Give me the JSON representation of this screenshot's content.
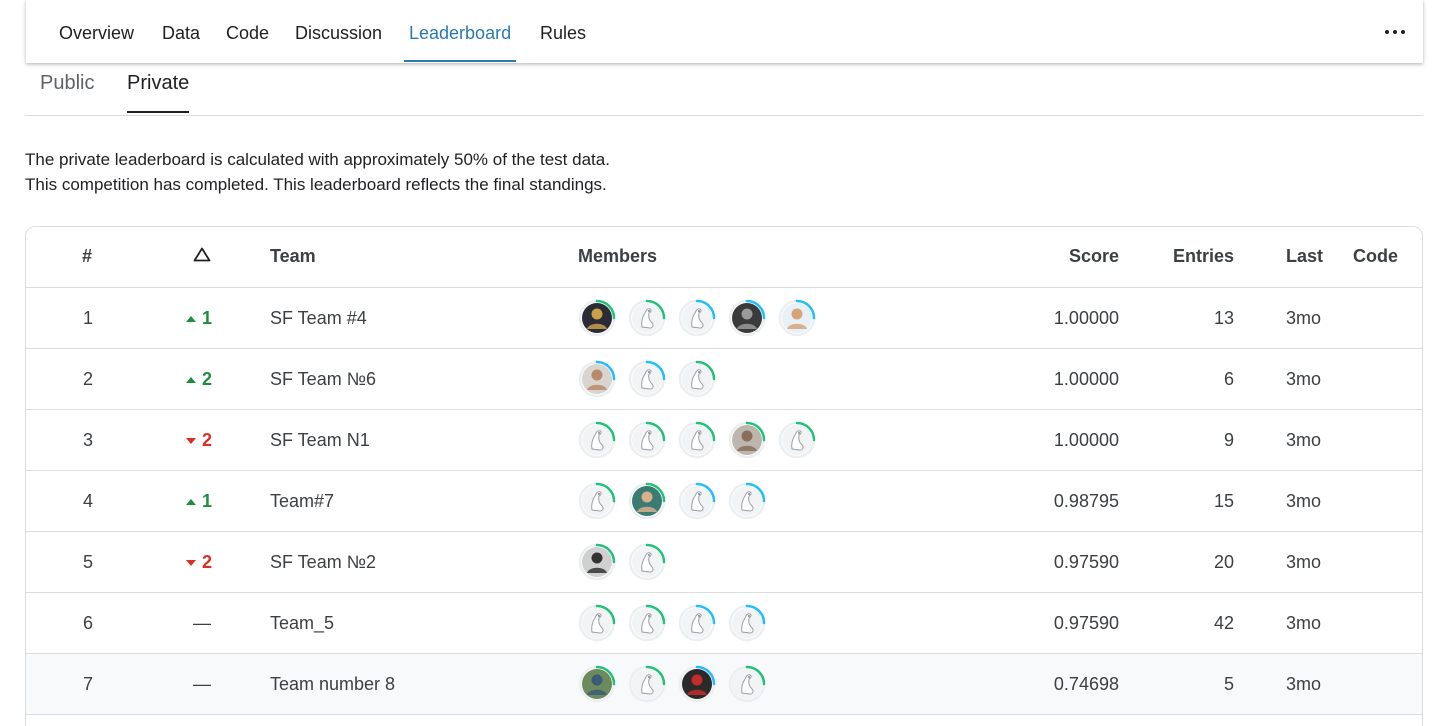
{
  "nav": {
    "tabs": [
      {
        "label": "Overview"
      },
      {
        "label": "Data"
      },
      {
        "label": "Code"
      },
      {
        "label": "Discussion"
      },
      {
        "label": "Leaderboard",
        "active": true
      },
      {
        "label": "Rules"
      }
    ],
    "more_icon": "more-horizontal-icon"
  },
  "subtabs": [
    {
      "label": "Public"
    },
    {
      "label": "Private",
      "active": true
    }
  ],
  "info": {
    "line1": "The private leaderboard is calculated with approximately 50% of the test data.",
    "line2": "This competition has completed. This leaderboard reflects the final standings."
  },
  "table": {
    "headers": {
      "rank": "#",
      "delta_icon": "delta-triangle-icon",
      "team": "Team",
      "members": "Members",
      "score": "Score",
      "entries": "Entries",
      "last": "Last",
      "code": "Code"
    },
    "colors": {
      "up": "#1e8e3e",
      "down": "#d93025",
      "ring_green": "#20c27a",
      "ring_blue": "#20beff"
    },
    "rows": [
      {
        "rank": "1",
        "delta_dir": "up",
        "delta": "1",
        "team": "SF Team #4",
        "members": [
          "photo-dark",
          "goose-green",
          "goose-blue",
          "photo-gray",
          "photo-cartoon"
        ],
        "score": "1.00000",
        "entries": "13",
        "last": "3mo"
      },
      {
        "rank": "2",
        "delta_dir": "up",
        "delta": "2",
        "team": "SF Team №6",
        "members": [
          "photo-face",
          "goose-blue",
          "goose-green"
        ],
        "score": "1.00000",
        "entries": "6",
        "last": "3mo"
      },
      {
        "rank": "3",
        "delta_dir": "down",
        "delta": "2",
        "team": "SF Team N1",
        "members": [
          "goose-green",
          "goose-green",
          "goose-green",
          "photo-face2",
          "goose-green"
        ],
        "score": "1.00000",
        "entries": "9",
        "last": "3mo"
      },
      {
        "rank": "4",
        "delta_dir": "up",
        "delta": "1",
        "team": "Team#7",
        "members": [
          "goose-green",
          "photo-teal",
          "goose-blue",
          "goose-blue"
        ],
        "score": "0.98795",
        "entries": "15",
        "last": "3mo"
      },
      {
        "rank": "5",
        "delta_dir": "down",
        "delta": "2",
        "team": "SF Team №2",
        "members": [
          "photo-bw",
          "goose-green"
        ],
        "score": "0.97590",
        "entries": "20",
        "last": "3mo"
      },
      {
        "rank": "6",
        "delta_dir": "same",
        "delta": "—",
        "team": "Team_5",
        "members": [
          "goose-green",
          "goose-green",
          "goose-blue",
          "goose-blue"
        ],
        "score": "0.97590",
        "entries": "42",
        "last": "3mo"
      },
      {
        "rank": "7",
        "delta_dir": "same",
        "delta": "—",
        "team": "Team number 8",
        "members": [
          "photo-outdoor",
          "goose-green",
          "photo-red",
          "goose-green"
        ],
        "score": "0.74698",
        "entries": "5",
        "last": "3mo",
        "highlight": true
      }
    ]
  }
}
